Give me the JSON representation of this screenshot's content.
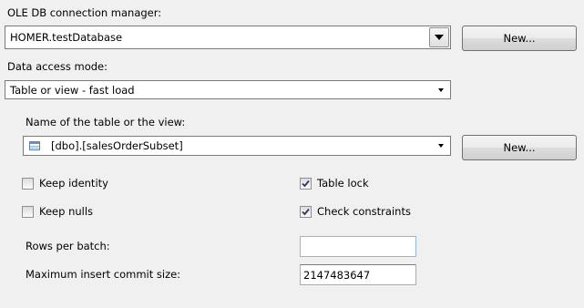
{
  "connection": {
    "label": "OLE DB connection manager:",
    "value": "HOMER.testDatabase",
    "new_button": "New..."
  },
  "access_mode": {
    "label": "Data access mode:",
    "value": "Table or view - fast load"
  },
  "table": {
    "label": "Name of the table or the view:",
    "value": "[dbo].[salesOrderSubset]",
    "icon": "table-icon",
    "new_button": "New..."
  },
  "options": {
    "keep_identity": {
      "label": "Keep identity",
      "checked": false
    },
    "keep_nulls": {
      "label": "Keep nulls",
      "checked": false
    },
    "table_lock": {
      "label": "Table lock",
      "checked": true
    },
    "check_constraints": {
      "label": "Check constraints",
      "checked": true
    }
  },
  "rows_per_batch": {
    "label": "Rows per batch:",
    "value": ""
  },
  "max_commit": {
    "label": "Maximum insert commit size:",
    "value": "2147483647"
  }
}
